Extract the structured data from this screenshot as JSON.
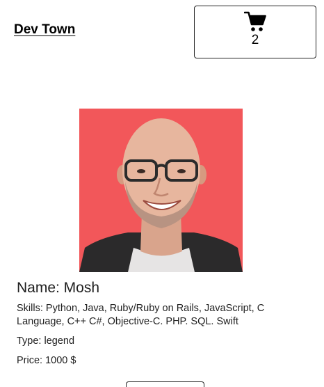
{
  "header": {
    "brand": "Dev Town",
    "cart_count": "2",
    "cart_icon": "shopping-cart-icon"
  },
  "profile": {
    "photo_background": "#f2575a",
    "name": "Name: Mosh",
    "skills": "Skills: Python, Java, Ruby/Ruby on Rails, JavaScript, C Language, C++ C#, Objective-C. PHP. SQL. Swift",
    "type": "Type: legend",
    "price": "Price: 1000 $"
  }
}
